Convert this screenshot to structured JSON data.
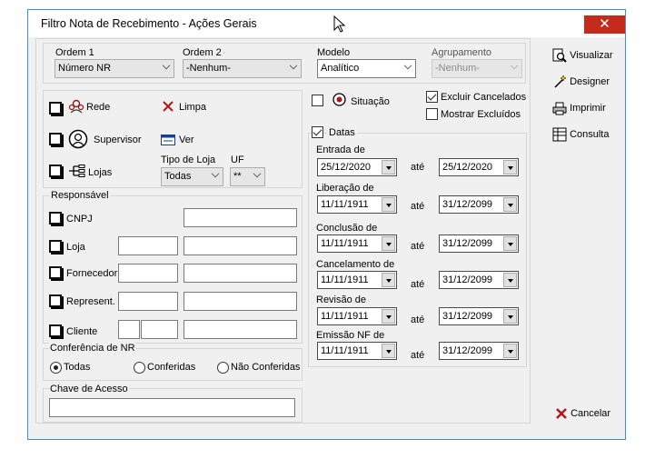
{
  "window": {
    "title": "Filtro Nota de Recebimento - Ações Gerais",
    "close_glyph": "✕"
  },
  "top": {
    "ordem1": {
      "label": "Ordem 1",
      "value": "Número NR"
    },
    "ordem2": {
      "label": "Ordem 2",
      "value": "-Nenhum-"
    },
    "modelo": {
      "label": "Modelo",
      "value": "Analítico"
    },
    "agrupamento": {
      "label": "Agrupamento",
      "value": "-Nenhum-"
    }
  },
  "options": {
    "rede": "Rede",
    "limpa": "Limpa",
    "supervisor": "Supervisor",
    "ver": "Ver",
    "lojas": "Lojas",
    "tipo_loja_label": "Tipo de Loja",
    "tipo_loja_value": "Todas",
    "uf_label": "UF",
    "uf_value": "**"
  },
  "responsavel": {
    "title": "Responsável",
    "rows": [
      "CNPJ",
      "Loja",
      "Fornecedor",
      "Represent.",
      "Cliente"
    ]
  },
  "conferencia": {
    "title": "Conferência de NR",
    "options": [
      "Todas",
      "Conferidas",
      "Não Conferidas"
    ],
    "selected": "Todas"
  },
  "chave": {
    "title": "Chave de Acesso",
    "value": ""
  },
  "situacao": "Situação",
  "excluir_cancelados": "Excluir Cancelados",
  "mostrar_excluidos": "Mostrar Excluídos",
  "datas": {
    "title": "Datas",
    "ate": "até",
    "rows": [
      {
        "label": "Entrada de",
        "from": "25/12/2020",
        "to": "25/12/2020"
      },
      {
        "label": "Liberação de",
        "from": "11/11/1911",
        "to": "31/12/2099"
      },
      {
        "label": "Conclusão de",
        "from": "11/11/1911",
        "to": "31/12/2099"
      },
      {
        "label": "Cancelamento de",
        "from": "11/11/1911",
        "to": "31/12/2099"
      },
      {
        "label": "Revisão de",
        "from": "11/11/1911",
        "to": "31/12/2099"
      },
      {
        "label": "Emissão NF de",
        "from": "11/11/1911",
        "to": "31/12/2099"
      }
    ]
  },
  "actions": {
    "visualizar": "Visualizar",
    "designer": "Designer",
    "imprimir": "Imprimir",
    "consulta": "Consulta",
    "cancelar": "Cancelar"
  },
  "icons": [
    "cursor-icon",
    "rede-icon",
    "limpa-x-icon",
    "supervisor-icon",
    "ver-icon",
    "lojas-icon",
    "situacao-icon",
    "visualizar-icon",
    "designer-icon",
    "imprimir-icon",
    "consulta-icon",
    "cancelar-icon"
  ]
}
